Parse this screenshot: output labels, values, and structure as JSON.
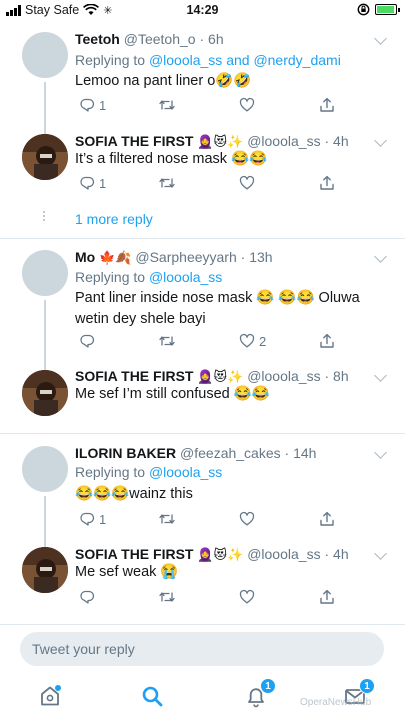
{
  "status_bar": {
    "carrier": "Stay Safe",
    "time": "14:29"
  },
  "tweets": [
    {
      "name": "Teetoh",
      "handle": "@Teetoh_o",
      "age": "6h",
      "reply_prefix": "Replying to",
      "reply_to": "@looola_ss and @nerdy_dami",
      "text": "Lemoo na pant liner o🤣🤣",
      "replies": "1",
      "retweets": "",
      "likes": ""
    },
    {
      "name": "SOFIA THE FIRST",
      "emoji": "🧕😻✨",
      "handle": "@looola_ss",
      "age": "4h",
      "text": "It’s a filtered nose mask 😂😂",
      "replies": "1",
      "retweets": "",
      "likes": ""
    },
    {
      "name": "Mo",
      "emoji": "🍁🍂",
      "handle": "@Sarpheeyyarh",
      "age": "13h",
      "reply_prefix": "Replying to",
      "reply_to": "@looola_ss",
      "text": "Pant liner inside nose mask 😂 😂😂 Oluwa wetin dey shele bayi",
      "replies": "",
      "retweets": "",
      "likes": "2"
    },
    {
      "name": "SOFIA THE FIRST",
      "emoji": "🧕😻✨",
      "handle": "@looola_ss",
      "age": "8h",
      "text": "Me sef I’m still confused 😂😂",
      "replies": "",
      "retweets": "",
      "likes": ""
    },
    {
      "name": "ILORIN BAKER",
      "emoji": "",
      "handle": "@feezah_cakes",
      "age": "14h",
      "reply_prefix": "Replying to",
      "reply_to": "@looola_ss",
      "text": "😂😂😂wainz this",
      "replies": "1",
      "retweets": "",
      "likes": ""
    },
    {
      "name": "SOFIA THE FIRST",
      "emoji": "🧕😻✨",
      "handle": "@looola_ss",
      "age": "4h",
      "text": "Me sef weak 😭",
      "replies": "",
      "retweets": "",
      "likes": ""
    }
  ],
  "more_replies": "1 more reply",
  "compose": {
    "placeholder": "Tweet your reply"
  },
  "tabbar": {
    "home_badge": "",
    "notifications_badge": "1",
    "messages_badge": "1"
  },
  "watermark": "OperaNewsHub",
  "colors": {
    "accent": "#1da1f2",
    "muted": "#657786",
    "divider": "#e1e8ed"
  }
}
